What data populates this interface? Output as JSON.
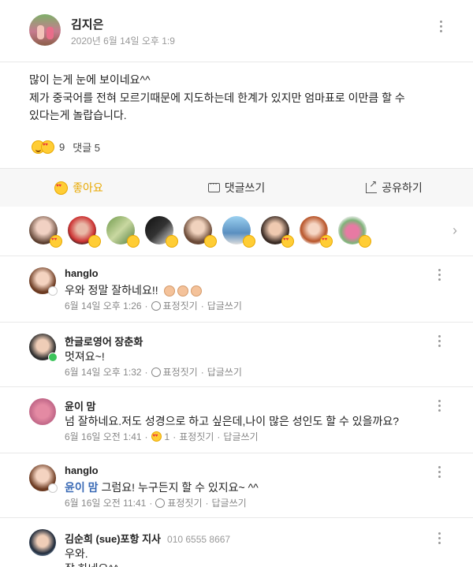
{
  "post": {
    "author": "김지은",
    "time": "2020년 6월 14일 오후 1:9",
    "body_line1": "많이 는게 눈에 보이네요^^",
    "body_line2": "제가 중국어를 전혀 모르기때문에 지도하는데 한계가 있지만 엄마표로 이만큼 할 수",
    "body_line3": "있다는게 놀랍습니다.",
    "reaction_count": "9",
    "comment_count_label": "댓글 5"
  },
  "actions": {
    "like": "좋아요",
    "comment": "댓글쓰기",
    "share": "공유하기"
  },
  "comments": [
    {
      "name": "hanglo",
      "text": "우와 정말 잘하네요!!",
      "time": "6월 14일 오후 1:26",
      "emote": "표정짓기",
      "reply": "답글쓰기"
    },
    {
      "name": "한글로영어 장춘화",
      "text": "멋져요~!",
      "time": "6월 14일 오후 1:32",
      "emote": "표정짓기",
      "reply": "답글쓰기"
    },
    {
      "name": "윤이 맘",
      "text": "넘 잘하네요.저도 성경으로 하고 싶은데,나이 많은 성인도 할 수 있을까요?",
      "time": "6월 16일 오전 1:41",
      "reaction_count": "1",
      "emote": "표정짓기",
      "reply": "답글쓰기"
    },
    {
      "name": "hanglo",
      "mention": "윤이 맘",
      "text": "그럼요! 누구든지 할 수 있지요~ ^^",
      "time": "6월 16일 오전 11:41",
      "emote": "표정짓기",
      "reply": "답글쓰기"
    },
    {
      "name": "김순희 (sue)포항 지사",
      "phone": "010 6555 8667",
      "text1": "우와.",
      "text2": "잘 하네요^^"
    }
  ],
  "colors": {
    "accent_like": "#e8a800",
    "mention": "#3a6ab5",
    "bar_bg": "#f7f7f7"
  }
}
